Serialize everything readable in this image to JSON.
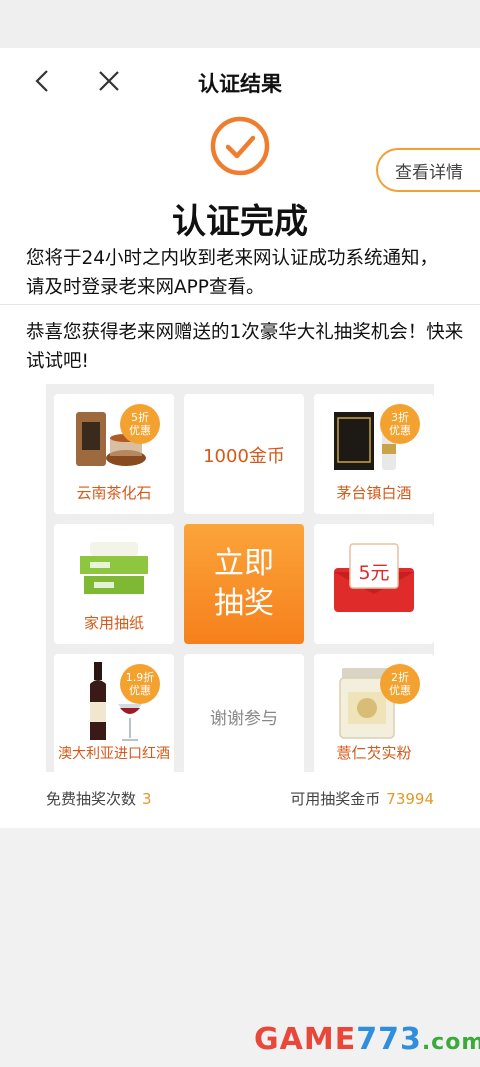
{
  "nav": {
    "title": "认证结果"
  },
  "detail_button": "查看详情",
  "result_title": "认证完成",
  "notice_text": "您将于24小时之内收到老来网认证成功系统通知，请及时登录老来网APP查看。",
  "congrats_text": "恭喜您获得老来网赠送的1次豪华大礼抽奖机会！快来试试吧!",
  "prizes": [
    {
      "label": "云南茶化石",
      "badge": [
        "5折",
        "优惠"
      ]
    },
    {
      "label": "1000金币"
    },
    {
      "label": "茅台镇白酒",
      "badge": [
        "3折",
        "优惠"
      ]
    },
    {
      "label": "家用抽纸"
    },
    {
      "label": "5元"
    },
    {
      "label": "澳大利亚进口红酒",
      "badge": [
        "1.9折",
        "优惠"
      ]
    },
    {
      "label": "谢谢参与"
    },
    {
      "label": "薏仁芡实粉",
      "badge": [
        "2折",
        "优惠"
      ]
    }
  ],
  "draw_button": [
    "立即",
    "抽奖"
  ],
  "footer": {
    "free_draws_label": "免费抽奖次数",
    "free_draws_value": "3",
    "coins_label": "可用抽奖金币",
    "coins_value": "73994"
  },
  "watermark": {
    "part1": "GAME",
    "part2": "773",
    "part3": ".com"
  },
  "colors": {
    "accent": "#f0a234",
    "draw_button": "#f6801c",
    "prize_text": "#d45a1a"
  }
}
